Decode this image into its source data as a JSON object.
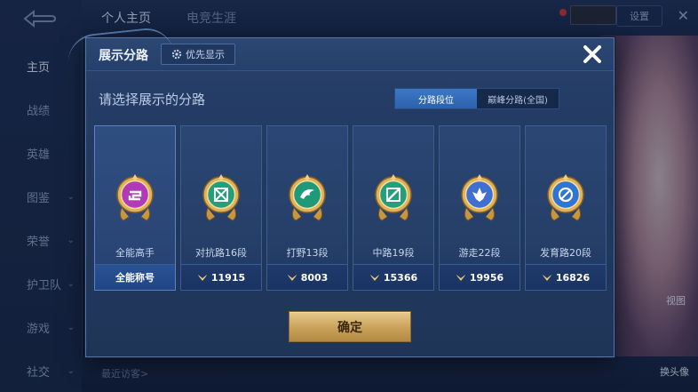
{
  "background": {
    "nav_items": [
      {
        "label": "主页",
        "arrow": false,
        "active": true
      },
      {
        "label": "战绩",
        "arrow": false
      },
      {
        "label": "英雄",
        "arrow": false
      },
      {
        "label": "图鉴",
        "arrow": true
      },
      {
        "label": "荣誉",
        "arrow": true
      },
      {
        "label": "护卫队",
        "arrow": true
      },
      {
        "label": "游戏",
        "arrow": true
      },
      {
        "label": "社交",
        "arrow": true
      }
    ],
    "tabs": [
      "个人主页",
      "电竞生涯"
    ],
    "settings_label": "设置",
    "recent_visitors_label": "最近访客>",
    "right_labels": [
      "视图",
      "换头像"
    ]
  },
  "modal": {
    "title": "展示分路",
    "priority_label": "优先显示",
    "prompt": "请选择展示的分路",
    "toggle": [
      "分路段位",
      "巅峰分路(全国)"
    ],
    "toggle_active_index": 0,
    "cards": [
      {
        "name": "全能高手",
        "footer": "全能称号",
        "points": false,
        "emblem": "all-round-emblem-icon",
        "color": "#b03ab8"
      },
      {
        "name": "对抗路16段",
        "footer": "11915",
        "points": true,
        "emblem": "clash-lane-emblem-icon",
        "color": "#23a07a"
      },
      {
        "name": "打野13段",
        "footer": "8003",
        "points": true,
        "emblem": "jungle-emblem-icon",
        "color": "#1f9a78"
      },
      {
        "name": "中路19段",
        "footer": "15366",
        "points": true,
        "emblem": "mid-lane-emblem-icon",
        "color": "#23a07a"
      },
      {
        "name": "游走22段",
        "footer": "19956",
        "points": true,
        "emblem": "roam-emblem-icon",
        "color": "#3f6fd0"
      },
      {
        "name": "发育路20段",
        "footer": "16826",
        "points": true,
        "emblem": "farm-lane-emblem-icon",
        "color": "#2f75d6"
      }
    ],
    "confirm_label": "确定"
  }
}
